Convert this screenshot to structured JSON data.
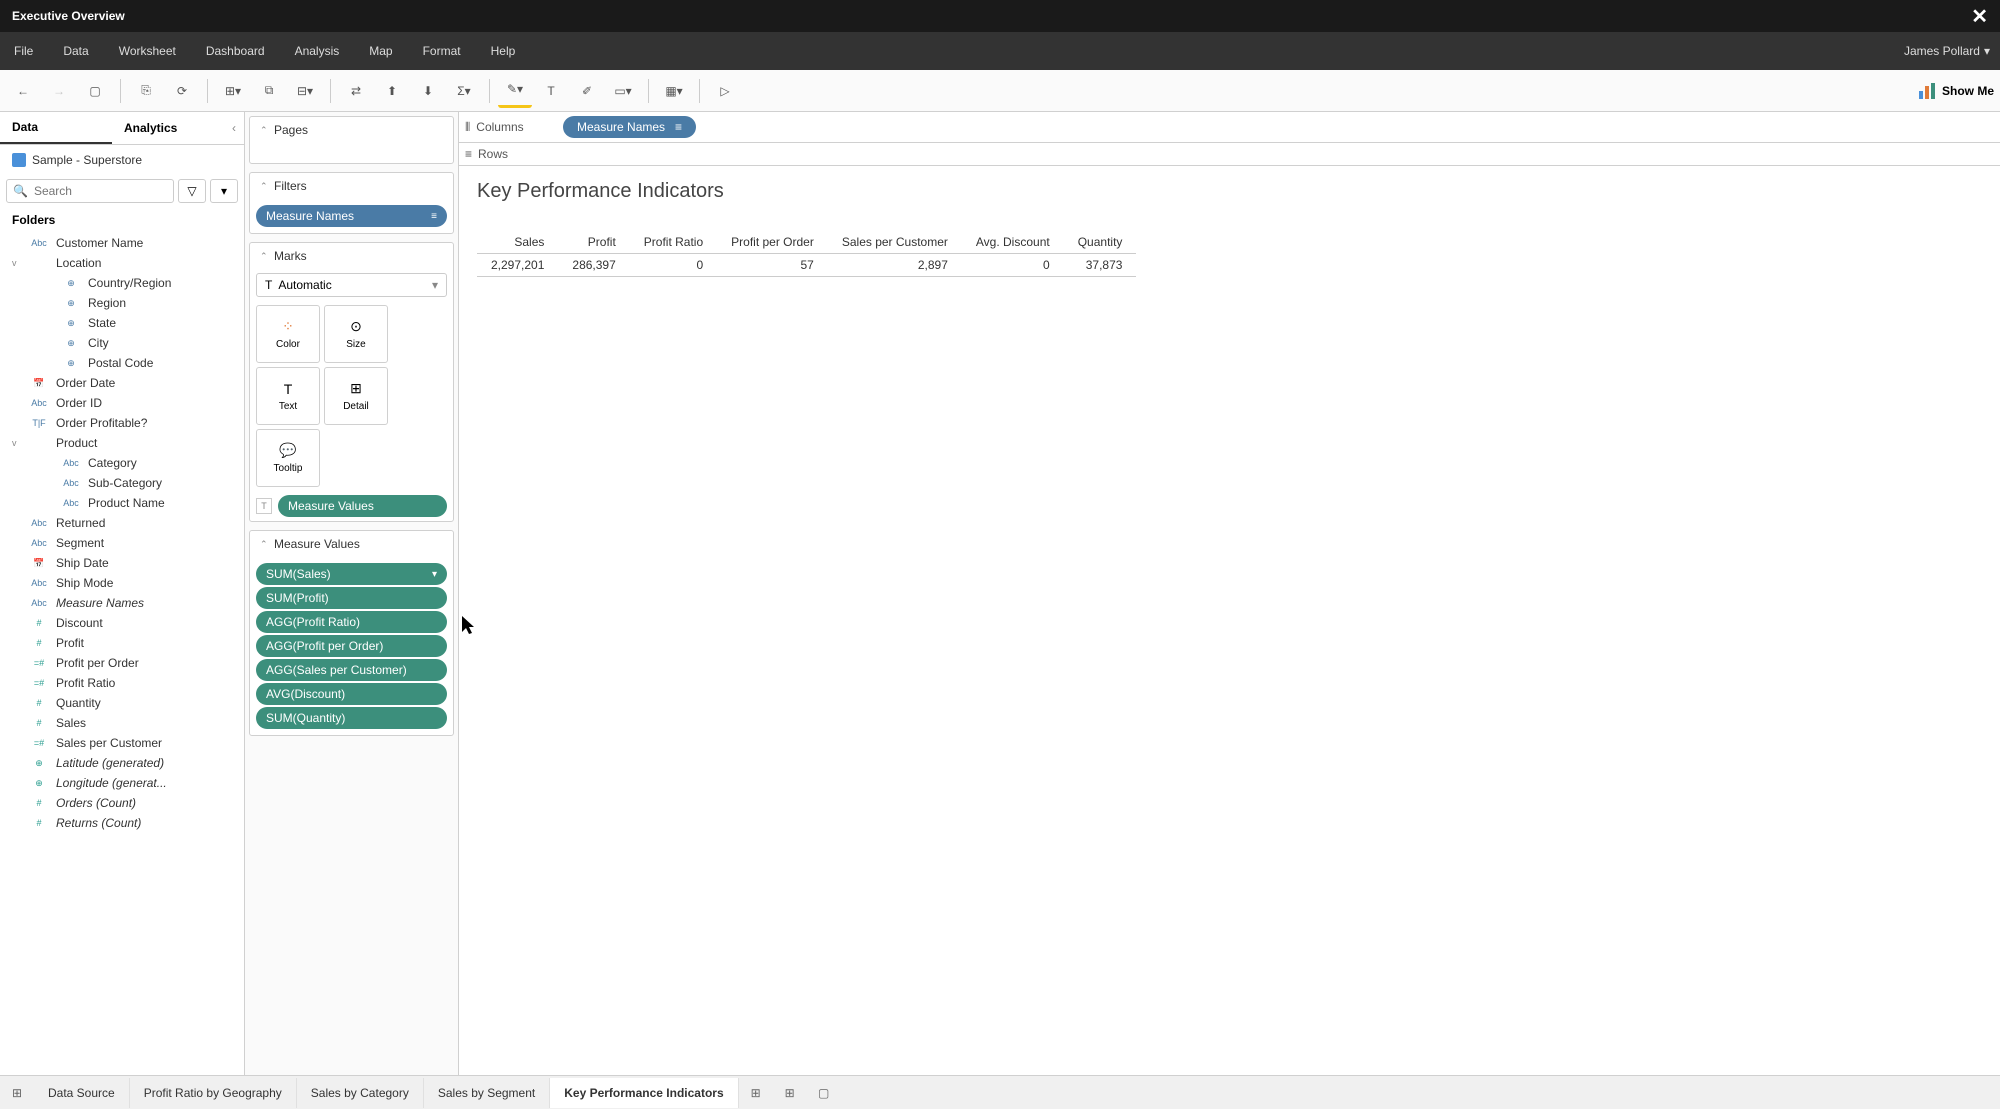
{
  "titlebar": {
    "title": "Executive Overview"
  },
  "menubar": {
    "items": [
      "File",
      "Data",
      "Worksheet",
      "Dashboard",
      "Analysis",
      "Map",
      "Format",
      "Help"
    ],
    "user": "James Pollard"
  },
  "toolbar": {
    "showme": "Show Me"
  },
  "left": {
    "tabs": {
      "data": "Data",
      "analytics": "Analytics"
    },
    "datasource": "Sample - Superstore",
    "search_placeholder": "Search",
    "folders_label": "Folders",
    "fields": [
      {
        "type": "Abc",
        "name": "Customer Name",
        "lvl": 0,
        "cls": ""
      },
      {
        "type": "",
        "name": "Location",
        "lvl": 0,
        "cls": "",
        "caret": "v"
      },
      {
        "type": "⊕",
        "name": "Country/Region",
        "lvl": 2,
        "cls": ""
      },
      {
        "type": "⊕",
        "name": "Region",
        "lvl": 2,
        "cls": ""
      },
      {
        "type": "⊕",
        "name": "State",
        "lvl": 2,
        "cls": ""
      },
      {
        "type": "⊕",
        "name": "City",
        "lvl": 2,
        "cls": ""
      },
      {
        "type": "⊕",
        "name": "Postal Code",
        "lvl": 2,
        "cls": ""
      },
      {
        "type": "📅",
        "name": "Order Date",
        "lvl": 0,
        "cls": ""
      },
      {
        "type": "Abc",
        "name": "Order ID",
        "lvl": 0,
        "cls": ""
      },
      {
        "type": "T|F",
        "name": "Order Profitable?",
        "lvl": 0,
        "cls": "calc"
      },
      {
        "type": "",
        "name": "Product",
        "lvl": 0,
        "cls": "",
        "caret": "v"
      },
      {
        "type": "Abc",
        "name": "Category",
        "lvl": 2,
        "cls": ""
      },
      {
        "type": "Abc",
        "name": "Sub-Category",
        "lvl": 2,
        "cls": ""
      },
      {
        "type": "Abc",
        "name": "Product Name",
        "lvl": 2,
        "cls": ""
      },
      {
        "type": "Abc",
        "name": "Returned",
        "lvl": 0,
        "cls": ""
      },
      {
        "type": "Abc",
        "name": "Segment",
        "lvl": 0,
        "cls": ""
      },
      {
        "type": "📅",
        "name": "Ship Date",
        "lvl": 0,
        "cls": ""
      },
      {
        "type": "Abc",
        "name": "Ship Mode",
        "lvl": 0,
        "cls": ""
      },
      {
        "type": "Abc",
        "name": "Measure Names",
        "lvl": 0,
        "cls": "italic"
      },
      {
        "type": "#",
        "name": "Discount",
        "lvl": 0,
        "cls": "green"
      },
      {
        "type": "#",
        "name": "Profit",
        "lvl": 0,
        "cls": "green"
      },
      {
        "type": "=#",
        "name": "Profit per Order",
        "lvl": 0,
        "cls": "green"
      },
      {
        "type": "=#",
        "name": "Profit Ratio",
        "lvl": 0,
        "cls": "green"
      },
      {
        "type": "#",
        "name": "Quantity",
        "lvl": 0,
        "cls": "green"
      },
      {
        "type": "#",
        "name": "Sales",
        "lvl": 0,
        "cls": "green"
      },
      {
        "type": "=#",
        "name": "Sales per Customer",
        "lvl": 0,
        "cls": "green"
      },
      {
        "type": "⊕",
        "name": "Latitude (generated)",
        "lvl": 0,
        "cls": "italic green"
      },
      {
        "type": "⊕",
        "name": "Longitude (generat...",
        "lvl": 0,
        "cls": "italic green"
      },
      {
        "type": "#",
        "name": "Orders (Count)",
        "lvl": 0,
        "cls": "italic green"
      },
      {
        "type": "#",
        "name": "Returns (Count)",
        "lvl": 0,
        "cls": "italic green"
      }
    ]
  },
  "mid": {
    "pages": "Pages",
    "filters": "Filters",
    "filter_pill": "Measure Names",
    "marks": "Marks",
    "mark_type": "Automatic",
    "markbtns": {
      "color": "Color",
      "size": "Size",
      "text": "Text",
      "detail": "Detail",
      "tooltip": "Tooltip"
    },
    "mv_pill": "Measure Values",
    "mv_header": "Measure Values",
    "mv_items": [
      "SUM(Sales)",
      "SUM(Profit)",
      "AGG(Profit Ratio)",
      "AGG(Profit per Order)",
      "AGG(Sales per Customer)",
      "AVG(Discount)",
      "SUM(Quantity)"
    ]
  },
  "canvas": {
    "columns_label": "Columns",
    "columns_pill": "Measure Names",
    "rows_label": "Rows",
    "title": "Key Performance Indicators"
  },
  "chart_data": {
    "type": "table",
    "columns": [
      "Sales",
      "Profit",
      "Profit Ratio",
      "Profit per Order",
      "Sales per Customer",
      "Avg. Discount",
      "Quantity"
    ],
    "rows": [
      [
        "2,297,201",
        "286,397",
        "0",
        "57",
        "2,897",
        "0",
        "37,873"
      ]
    ]
  },
  "bottom": {
    "ds": "Data Source",
    "tabs": [
      "Profit Ratio by Geography",
      "Sales by Category",
      "Sales by Segment",
      "Key Performance Indicators"
    ],
    "active": 3
  }
}
